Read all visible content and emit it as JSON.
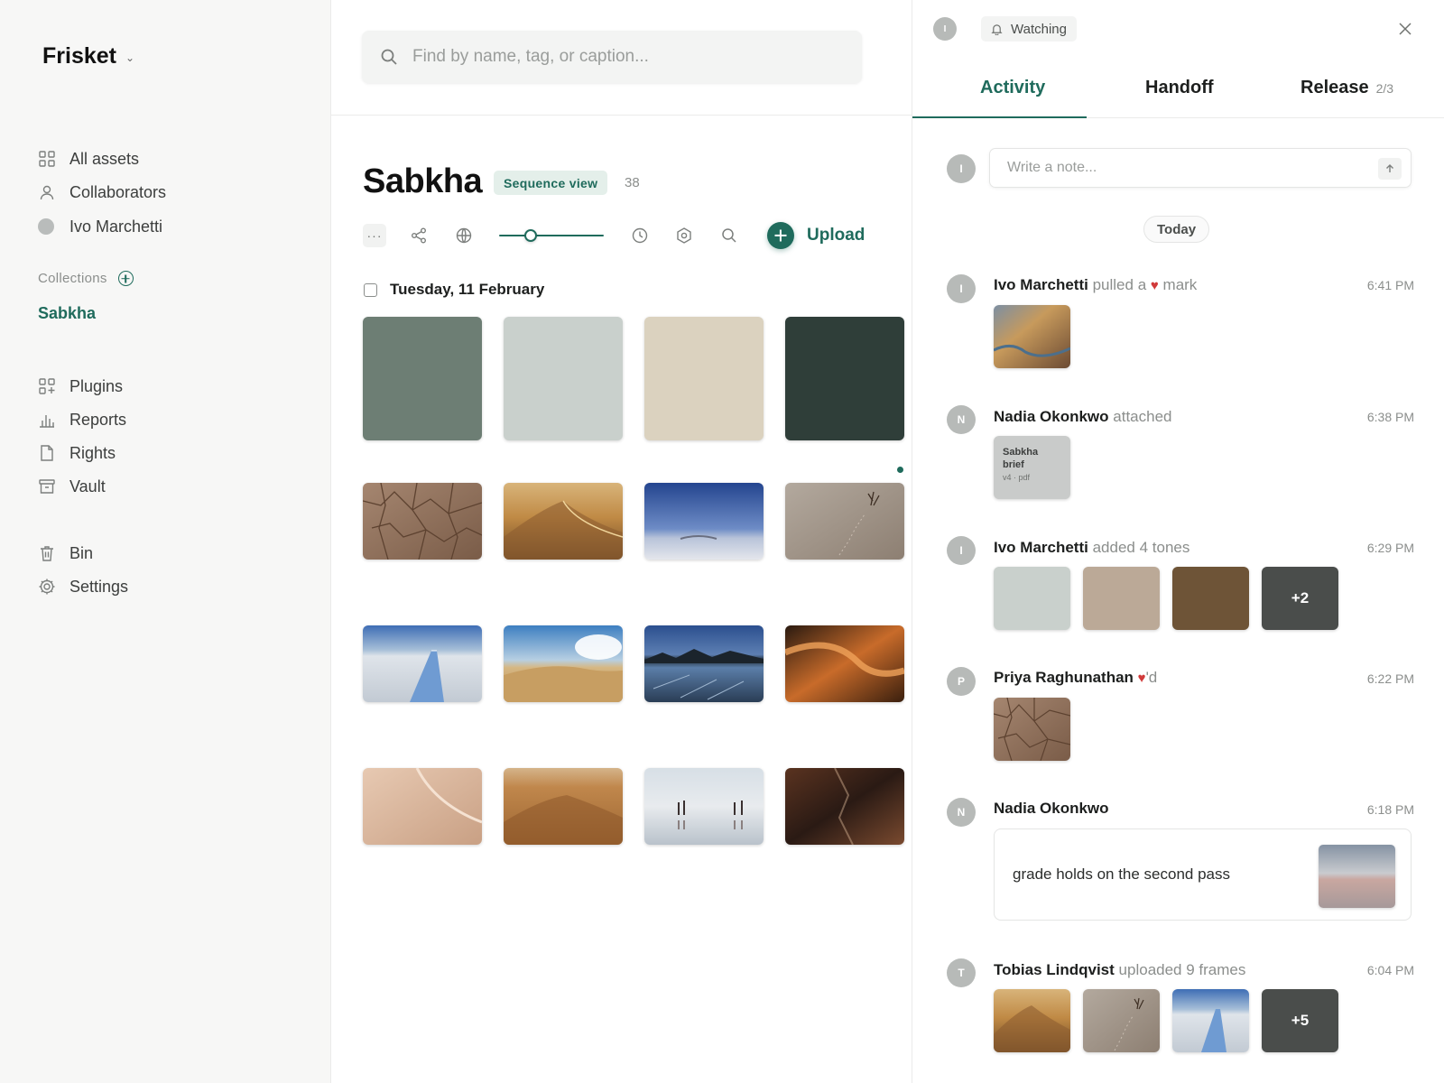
{
  "app": {
    "name": "Frisket"
  },
  "sidebar": {
    "nav": [
      {
        "label": "All assets",
        "icon": "grid-icon"
      },
      {
        "label": "Collaborators",
        "icon": "person-icon"
      },
      {
        "label": "Ivo Marchetti",
        "icon": "avatar"
      }
    ],
    "collections_label": "Collections",
    "active_collection": "Sabkha",
    "tools": [
      {
        "label": "Plugins",
        "icon": "plugins-icon"
      },
      {
        "label": "Reports",
        "icon": "bar-chart-icon"
      },
      {
        "label": "Rights",
        "icon": "document-icon"
      },
      {
        "label": "Vault",
        "icon": "archive-icon"
      }
    ],
    "system": [
      {
        "label": "Bin",
        "icon": "trash-icon"
      },
      {
        "label": "Settings",
        "icon": "gear-icon"
      }
    ]
  },
  "main": {
    "search_placeholder": "Find by name, tag, or caption...",
    "title": "Sabkha",
    "view_badge": "Sequence view",
    "asset_count": "38",
    "more_label": "···",
    "zoom_fraction": 0.27,
    "upload_label": "Upload",
    "date_group": "Tuesday, 11 February",
    "swatches": [
      "#6d7e74",
      "#c9d0cc",
      "#dbd2bf",
      "#2f3e39"
    ]
  },
  "panel": {
    "owner_initial": "I",
    "watching_label": "Watching",
    "tabs": [
      {
        "label": "Activity",
        "active": true,
        "extra": ""
      },
      {
        "label": "Handoff",
        "active": false,
        "extra": ""
      },
      {
        "label": "Release",
        "active": false,
        "extra": "2/3"
      }
    ],
    "note_placeholder": "Write a note...",
    "note_avatar": "I",
    "today_label": "Today",
    "activity": [
      {
        "initial": "I",
        "who": "Ivo Marchetti",
        "action_before": "pulled a",
        "action_after": "mark",
        "time": "6:41 PM"
      },
      {
        "initial": "N",
        "who": "Nadia Okonkwo",
        "action": "attached",
        "time": "6:38 PM",
        "file_name": "Sabkha brief",
        "file_meta": "v4 · pdf"
      },
      {
        "initial": "I",
        "who": "Ivo Marchetti",
        "action": "added 4 tones",
        "time": "6:29 PM",
        "tones": [
          "#c9d0cc",
          "#bba997",
          "#6e5437"
        ],
        "more": "+2"
      },
      {
        "initial": "P",
        "who": "Priya Raghunathan",
        "action": "'d",
        "time": "6:22 PM"
      },
      {
        "initial": "N",
        "who": "Nadia Okonkwo",
        "action": "",
        "time": "6:18 PM",
        "comment": "grade holds on the second pass"
      },
      {
        "initial": "T",
        "who": "Tobias Lindqvist",
        "action": "uploaded 9 frames",
        "time": "6:04 PM",
        "more": "+5"
      }
    ]
  },
  "colors": {
    "accent": "#1f6b5c",
    "heart": "#d13a3a"
  }
}
